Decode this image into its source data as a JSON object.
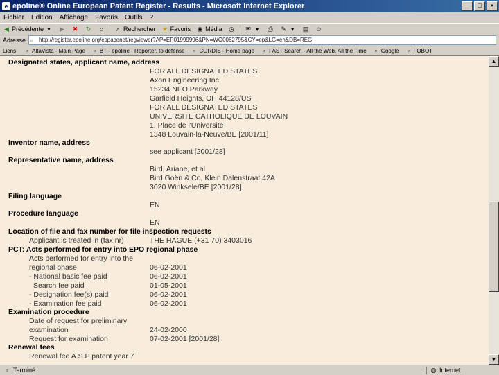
{
  "window": {
    "title": "epoline® Online European Patent Register - Results - Microsoft Internet Explorer",
    "controls": [
      "_",
      "□",
      "×"
    ]
  },
  "menu": [
    "Fichier",
    "Edition",
    "Affichage",
    "Favoris",
    "Outils",
    "?"
  ],
  "toolbar": {
    "back": "Précédente",
    "search": "Rechercher",
    "favorites": "Favoris",
    "media": "Média"
  },
  "address": {
    "label": "Adresse",
    "url": "http://register.epoline.org/espacenet/regviewer?AP=EP01999996&PN=WO0062795&CY=ep&LG=en&DB=REG"
  },
  "links": {
    "label": "Liens",
    "items": [
      "AltaVista - Main Page",
      "BT - epoline - Reporter, to defense",
      "CORDIS - Home page",
      "FAST Search - All the Web, All the Time",
      "Google",
      "FOBOT"
    ]
  },
  "patent": {
    "designated": {
      "heading": "Designated states, applicant name, address",
      "lines": [
        "FOR ALL DESIGNATED STATES",
        "Axon Engineering Inc.",
        "15234 NEO Parkway",
        "Garfield Heights, OH 44128/US",
        "FOR ALL DESIGNATED STATES",
        "UNIVERSITE CATHOLIQUE DE LOUVAIN",
        "1, Place de l'Université",
        "1348 Louvain-la-Neuve/BE [2001/11]"
      ]
    },
    "inventor": {
      "heading": "Inventor name, address",
      "lines": [
        "see applicant [2001/28]"
      ]
    },
    "representative": {
      "heading": "Representative name, address",
      "lines": [
        "Bird, Ariane, et al",
        "Bird Goën & Co, Klein Dalenstraat 42A",
        "3020 Winksele/BE [2001/28]"
      ]
    },
    "filing_language": {
      "heading": "Filing language",
      "value": "EN"
    },
    "procedure_language": {
      "heading": "Procedure language",
      "value": "EN"
    },
    "location": {
      "heading": "Location of file and fax number for file inspection requests",
      "label": "Applicant is treated in (fax nr)",
      "value": "THE HAGUE (+31 70) 3403016"
    },
    "pct": {
      "heading": "PCT: Acts performed for entry into EPO regional phase",
      "items": [
        {
          "label": "Acts performed for entry into the",
          "value": ""
        },
        {
          "label": "regional phase",
          "value": "06-02-2001"
        },
        {
          "label": "- National basic fee paid",
          "value": "06-02-2001"
        },
        {
          "label": "Search fee paid",
          "value": "01-05-2001"
        },
        {
          "label": "- Designation fee(s) paid",
          "value": "06-02-2001"
        },
        {
          "label": "- Examination fee paid",
          "value": "06-02-2001"
        }
      ]
    },
    "examination": {
      "heading": "Examination procedure",
      "items": [
        {
          "label": "Date of request for preliminary",
          "value": ""
        },
        {
          "label": "examination",
          "value": "24-02-2000"
        },
        {
          "label": "Request for examination",
          "value": "07-02-2001 [2001/28]"
        }
      ]
    },
    "renewal": {
      "heading": "Renewal fees",
      "items": [
        {
          "label": "Renewal fee A.S.P patent year 7",
          "value": ""
        }
      ]
    }
  },
  "status": {
    "text": "Terminé",
    "zone": "Internet"
  }
}
